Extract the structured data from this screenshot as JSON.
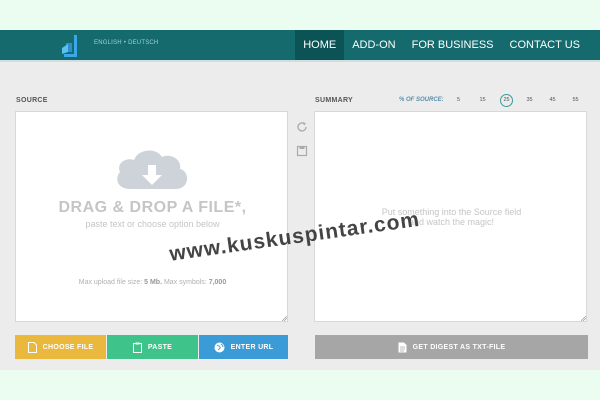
{
  "header": {
    "lang_en": "ENGLISH",
    "lang_sep": "•",
    "lang_de": "DEUTSCH",
    "nav": [
      {
        "label": "HOME",
        "active": true
      },
      {
        "label": "ADD-ON",
        "active": false
      },
      {
        "label": "FOR BUSINESS",
        "active": false
      },
      {
        "label": "CONTACT US",
        "active": false
      }
    ]
  },
  "source": {
    "label": "SOURCE",
    "drag_title": "DRAG & DROP A FILE*,",
    "drag_sub": "paste text or choose option below",
    "upload_prefix": "Max upload file size: ",
    "upload_size": "5 Mb.",
    "upload_mid": " Max symbols: ",
    "upload_symbols": "7,000"
  },
  "summary": {
    "label": "SUMMARY",
    "pct_label": "% OF SOURCE:",
    "pct_options": [
      "5",
      "15",
      "25",
      "35",
      "45",
      "55"
    ],
    "pct_selected": "25",
    "hint_line1": "Put something into the Source field",
    "hint_line2": "and watch the magic!"
  },
  "buttons": {
    "choose": "CHOOSE FILE",
    "paste": "PASTE",
    "url": "ENTER URL",
    "digest": "GET DIGEST AS TXT-FILE"
  },
  "watermark": "www.kuskuspintar.com",
  "icons": {
    "logo": "logo-icon",
    "cloud": "cloud-download-icon",
    "refresh": "refresh-icon",
    "copy": "copy-icon",
    "file": "file-icon",
    "clipboard": "clipboard-icon",
    "globe": "globe-icon",
    "digest": "document-icon"
  },
  "colors": {
    "header": "#146a6c",
    "nav_active": "#0c5355",
    "choose": "#e9b83c",
    "paste": "#3ec48b",
    "url": "#3a9bd6",
    "digest": "#a6a6a6"
  }
}
